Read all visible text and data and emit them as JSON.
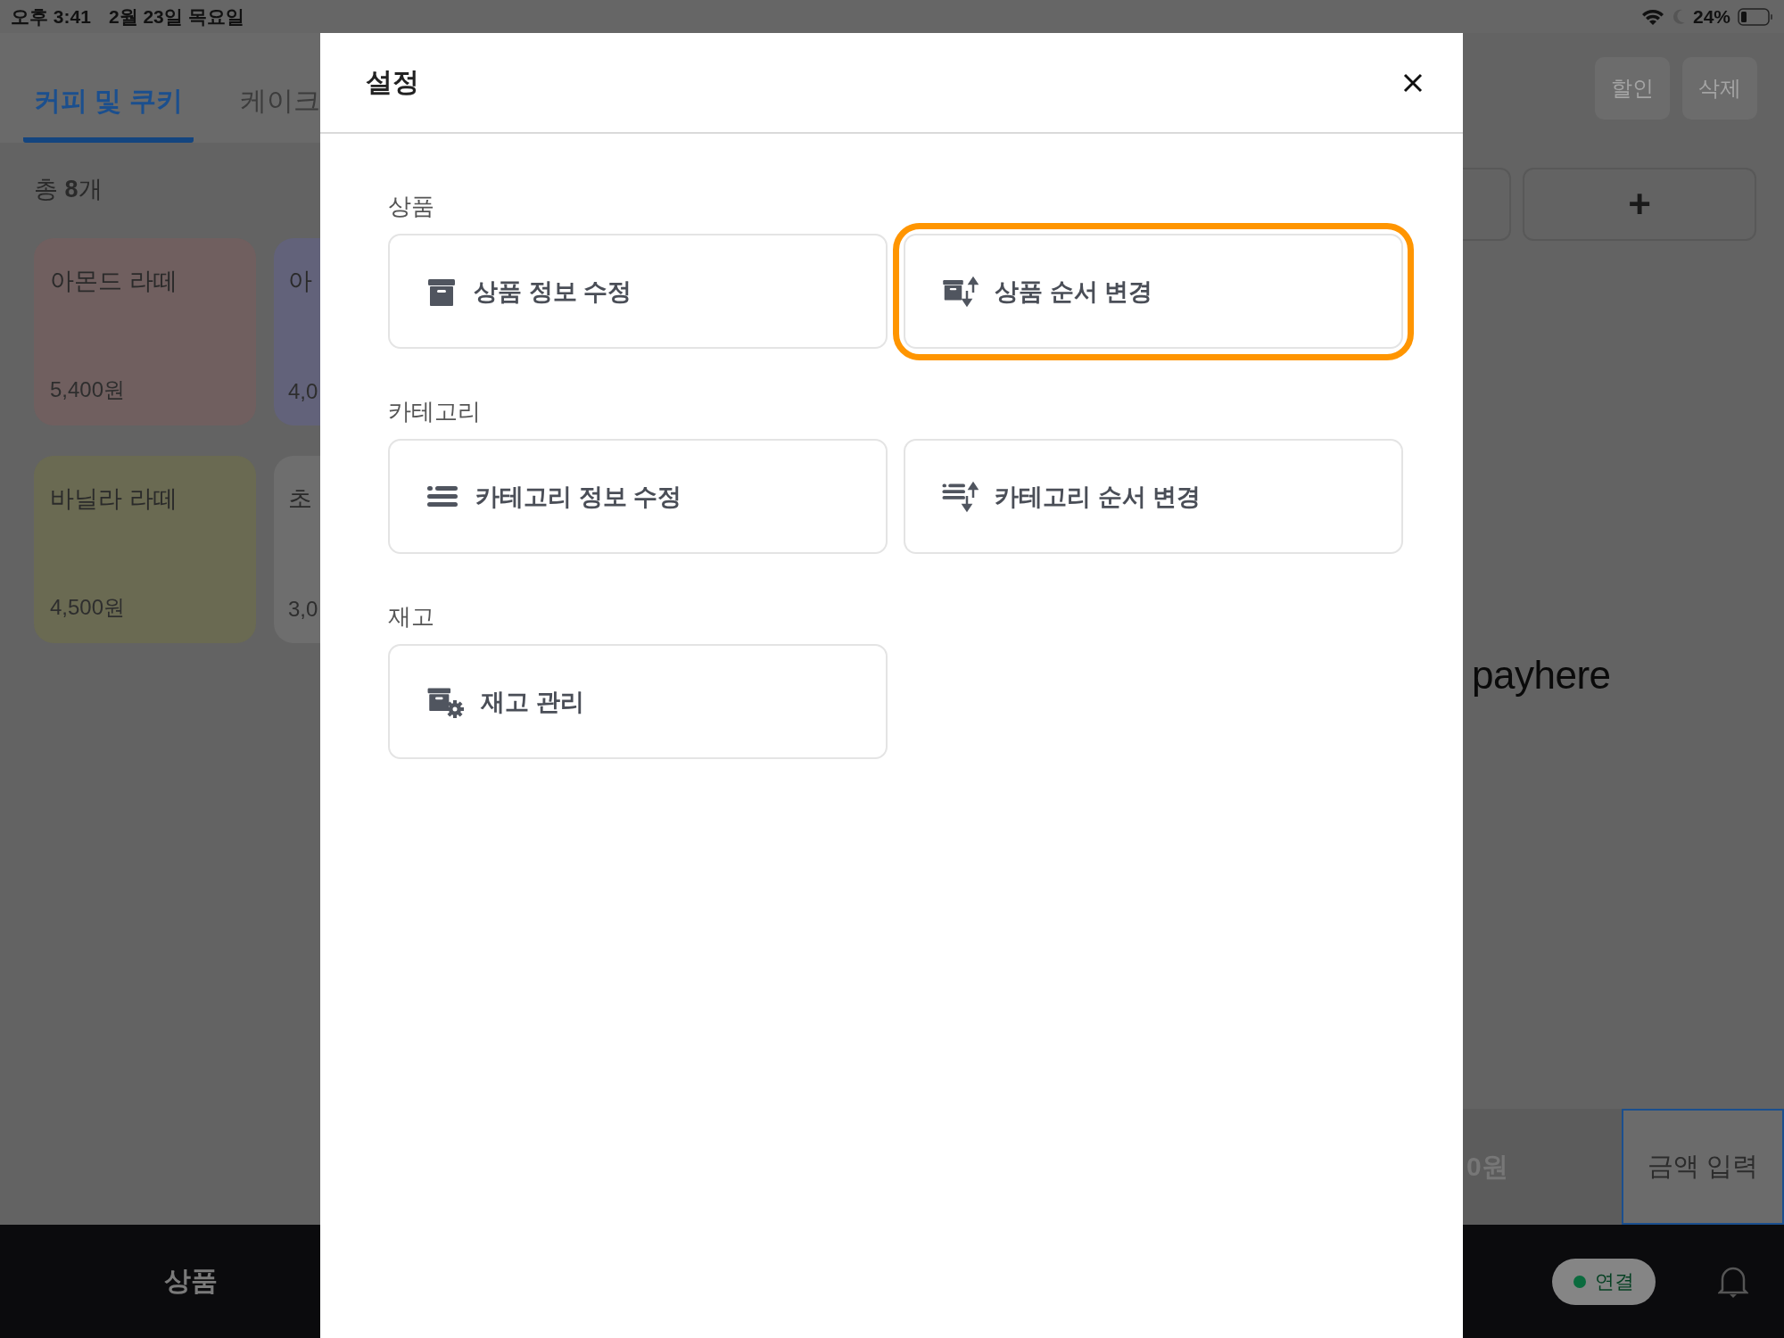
{
  "status_bar": {
    "time": "오후 3:41",
    "date": "2월 23일 목요일",
    "battery": "24%"
  },
  "background": {
    "tabs": [
      {
        "label": "커피 및 쿠키",
        "selected": true
      },
      {
        "label": "케이크",
        "selected": false
      }
    ],
    "count": "총 **8**개",
    "products": [
      {
        "name": "아몬드 라떼",
        "price": "5,400원",
        "color": "#705f5f"
      },
      {
        "name": "아",
        "price": "4,0",
        "color": "#62627a"
      },
      {
        "name": "바닐라 라떼",
        "price": "4,500원",
        "color": "#6a6a52"
      },
      {
        "name": "초",
        "price": "3,0",
        "color": "#6e6e6e"
      }
    ],
    "actions": [
      "할인",
      "삭제"
    ],
    "add_button": "+",
    "brand": "payhere",
    "total": "0원",
    "amount_button": "금액 입력",
    "nav_label": "상품",
    "connection": {
      "label": "연결",
      "connected": true
    }
  },
  "dialog": {
    "title": "설정",
    "sections": [
      {
        "label": "상품",
        "items": [
          {
            "label": "상품 정보 수정",
            "kind": "box",
            "highlighted": false
          },
          {
            "label": "상품 순서 변경",
            "kind": "box-sort",
            "highlighted": true
          }
        ]
      },
      {
        "label": "카테고리",
        "items": [
          {
            "label": "카테고리 정보 수정",
            "kind": "list",
            "highlighted": false
          },
          {
            "label": "카테고리 순서 변경",
            "kind": "list-sort",
            "highlighted": false
          }
        ]
      },
      {
        "label": "재고",
        "items": [
          {
            "label": "재고 관리",
            "kind": "box-gear",
            "highlighted": false
          }
        ]
      }
    ]
  }
}
